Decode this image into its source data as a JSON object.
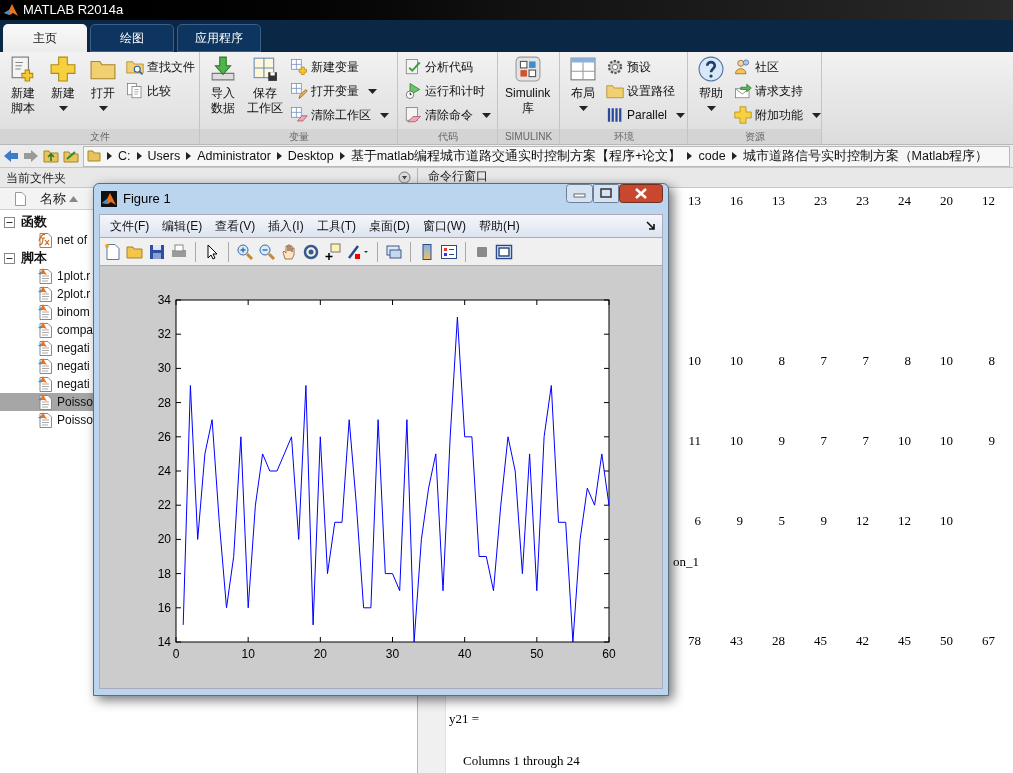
{
  "window": {
    "title": "MATLAB R2014a"
  },
  "tabs": [
    {
      "label": "主页",
      "selected": true
    },
    {
      "label": "绘图",
      "selected": false
    },
    {
      "label": "应用程序",
      "selected": false
    }
  ],
  "ribbon": {
    "groups": [
      {
        "label": "文件",
        "buttons": [
          {
            "kind": "large",
            "lines": [
              "新建",
              "脚本"
            ],
            "dropdown": false
          },
          {
            "kind": "large",
            "lines": [
              "新建"
            ],
            "dropdown": true
          },
          {
            "kind": "large",
            "lines": [
              "打开"
            ],
            "dropdown": true
          },
          {
            "kind": "small",
            "lines": [
              "查找文件"
            ],
            "dropdown": false
          },
          {
            "kind": "small",
            "lines": [
              "比较"
            ],
            "dropdown": false
          }
        ]
      },
      {
        "label": "变量",
        "buttons": [
          {
            "kind": "large",
            "lines": [
              "导入",
              "数据"
            ],
            "dropdown": false
          },
          {
            "kind": "large",
            "lines": [
              "保存",
              "工作区"
            ],
            "dropdown": false
          },
          {
            "kind": "small",
            "lines": [
              "新建变量"
            ],
            "dropdown": false
          },
          {
            "kind": "small",
            "lines": [
              "打开变量"
            ],
            "dropdown": true
          },
          {
            "kind": "small",
            "lines": [
              "清除工作区"
            ],
            "dropdown": true
          }
        ]
      },
      {
        "label": "代码",
        "buttons": [
          {
            "kind": "small",
            "lines": [
              "分析代码"
            ],
            "dropdown": false
          },
          {
            "kind": "small",
            "lines": [
              "运行和计时"
            ],
            "dropdown": false
          },
          {
            "kind": "small",
            "lines": [
              "清除命令"
            ],
            "dropdown": true
          }
        ]
      },
      {
        "label": "SIMULINK",
        "buttons": [
          {
            "kind": "large",
            "lines": [
              "Simulink",
              "库"
            ],
            "dropdown": false
          }
        ]
      },
      {
        "label": "环境",
        "buttons": [
          {
            "kind": "large",
            "lines": [
              "布局"
            ],
            "dropdown": true
          },
          {
            "kind": "small",
            "lines": [
              "预设"
            ],
            "dropdown": false
          },
          {
            "kind": "small",
            "lines": [
              "设置路径"
            ],
            "dropdown": false
          },
          {
            "kind": "small",
            "lines": [
              "Parallel"
            ],
            "dropdown": true
          }
        ]
      },
      {
        "label": "资源",
        "buttons": [
          {
            "kind": "large",
            "lines": [
              "帮助"
            ],
            "dropdown": true
          },
          {
            "kind": "small",
            "lines": [
              "社区"
            ],
            "dropdown": false
          },
          {
            "kind": "small",
            "lines": [
              "请求支持"
            ],
            "dropdown": false
          },
          {
            "kind": "small",
            "lines": [
              "附加功能"
            ],
            "dropdown": true
          }
        ]
      }
    ]
  },
  "address_bar": {
    "segments": [
      "C:",
      "Users",
      "Administrator",
      "Desktop",
      "基于matlab编程城市道路交通实时控制方案【程序+论文】",
      "code",
      "城市道路信号实时控制方案（Matlab程序）"
    ]
  },
  "current_folder": {
    "title": "当前文件夹",
    "column": "名称",
    "groups": [
      {
        "label": "函数",
        "expanded": true,
        "children": [
          {
            "name": "net of",
            "kind": "function",
            "selected": false
          }
        ]
      },
      {
        "label": "脚本",
        "expanded": true,
        "children": [
          {
            "name": "1plot.r",
            "kind": "script",
            "selected": false
          },
          {
            "name": "2plot.r",
            "kind": "script",
            "selected": false
          },
          {
            "name": "binom",
            "kind": "script",
            "selected": false
          },
          {
            "name": "compa",
            "kind": "script",
            "selected": false
          },
          {
            "name": "negati",
            "kind": "script",
            "selected": false
          },
          {
            "name": "negati",
            "kind": "script",
            "selected": false
          },
          {
            "name": "negati",
            "kind": "script",
            "selected": false
          },
          {
            "name": "Poisso",
            "kind": "script",
            "selected": true
          },
          {
            "name": "Poisso",
            "kind": "script",
            "selected": false
          }
        ]
      }
    ]
  },
  "command_window": {
    "title": "命令行窗口",
    "lines": [
      {
        "kind": "numbers",
        "values": [
          "13",
          "16",
          "13",
          "23",
          "23",
          "24",
          "20",
          "12"
        ]
      },
      {
        "kind": "numbers",
        "values": [
          "10",
          "10",
          "8",
          "7",
          "7",
          "8",
          "10",
          "8"
        ]
      },
      {
        "kind": "numbers",
        "values": [
          "11",
          "10",
          "9",
          "7",
          "7",
          "10",
          "10",
          "9"
        ]
      },
      {
        "kind": "numbers",
        "values": [
          "6",
          "9",
          "5",
          "9",
          "12",
          "12",
          "10"
        ]
      },
      {
        "kind": "cut",
        "text": "on_1"
      },
      {
        "kind": "numbers",
        "values": [
          "78",
          "43",
          "28",
          "45",
          "42",
          "45",
          "50",
          "67"
        ]
      },
      {
        "kind": "text",
        "text": "y21 ="
      },
      {
        "kind": "indented",
        "text": "Columns 1 through 24"
      }
    ]
  },
  "figure": {
    "title": "Figure 1",
    "menu": [
      "文件(F)",
      "编辑(E)",
      "查看(V)",
      "插入(I)",
      "工具(T)",
      "桌面(D)",
      "窗口(W)",
      "帮助(H)"
    ],
    "chart_data": {
      "type": "line",
      "xlim": [
        0,
        60
      ],
      "ylim": [
        14,
        34
      ],
      "xticks": [
        0,
        10,
        20,
        30,
        40,
        50,
        60
      ],
      "yticks": [
        14,
        16,
        18,
        20,
        22,
        24,
        26,
        28,
        30,
        32,
        34
      ],
      "x": [
        1,
        2,
        3,
        4,
        5,
        6,
        7,
        8,
        9,
        10,
        11,
        12,
        13,
        14,
        15,
        16,
        17,
        18,
        19,
        20,
        21,
        22,
        23,
        24,
        25,
        26,
        27,
        28,
        29,
        30,
        31,
        32,
        33,
        34,
        35,
        36,
        37,
        38,
        39,
        40,
        41,
        42,
        43,
        44,
        45,
        46,
        47,
        48,
        49,
        50,
        51,
        52,
        53,
        54,
        55,
        56,
        57,
        58,
        59,
        60
      ],
      "series": [
        {
          "color": "#0000ff",
          "values": [
            15,
            29,
            20,
            25,
            27,
            21,
            16,
            19,
            26,
            16,
            22,
            25,
            24,
            24,
            25,
            26,
            20,
            29,
            15,
            26,
            18,
            21,
            21,
            27,
            22,
            16,
            16,
            27,
            18,
            18,
            17,
            27,
            14,
            20,
            23,
            25,
            17,
            26,
            33,
            26,
            26,
            19,
            19,
            17,
            22,
            26,
            24,
            18,
            25,
            17,
            26,
            29,
            21,
            21,
            14,
            20,
            23,
            22,
            25,
            22
          ]
        }
      ]
    }
  }
}
